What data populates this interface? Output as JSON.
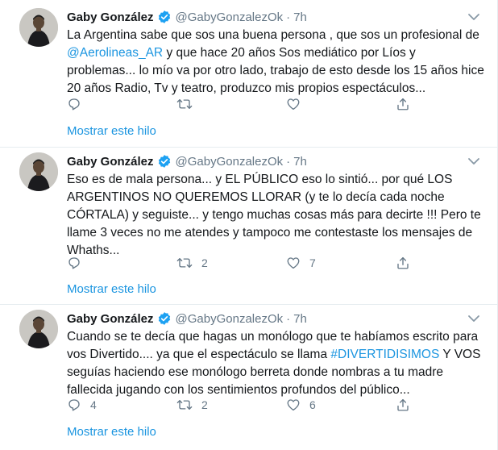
{
  "tweets": [
    {
      "name": "Gaby González",
      "handle": "@GabyGonzalezOk",
      "separator": "·",
      "time": "7h",
      "text_before_link": "La Argentina sabe que sos una buena persona , que sos un profesional de ",
      "link": "@Aerolineas_AR",
      "text_after_link": " y que hace 20 años Sos mediático por Líos y problemas... lo mío va por otro lado, trabajo de esto desde los 15 años hice 20 años Radio, Tv y teatro, produzco mis propios espectáculos...",
      "reply_count": "",
      "retweet_count": "",
      "like_count": "",
      "show_thread": "Mostrar este hilo"
    },
    {
      "name": "Gaby González",
      "handle": "@GabyGonzalezOk",
      "separator": "·",
      "time": "7h",
      "text": "Eso es de mala persona... y EL PÚBLICO eso lo sintió... por qué LOS ARGENTINOS NO QUEREMOS LLORAR (y te lo decía cada noche CÓRTALA) y seguiste... y tengo muchas cosas más para decirte !!! Pero te llame 3 veces no me atendes y tampoco me contestaste los mensajes de Whaths...",
      "reply_count": "",
      "retweet_count": "2",
      "like_count": "7",
      "show_thread": "Mostrar este hilo"
    },
    {
      "name": "Gaby González",
      "handle": "@GabyGonzalezOk",
      "separator": "·",
      "time": "7h",
      "text_before_link": "Cuando se te decía que hagas un monólogo que te habíamos escrito para vos Divertido.... ya que el espectáculo se llama ",
      "link": "#DIVERTIDISIMOS",
      "text_after_link": " Y VOS seguías haciendo ese monólogo berreta donde nombras a tu madre fallecida jugando con los sentimientos profundos del público...",
      "reply_count": "4",
      "retweet_count": "2",
      "like_count": "6",
      "show_thread": "Mostrar este hilo"
    }
  ],
  "icons": {
    "verified": "verified-badge-icon",
    "caret": "chevron-down-icon",
    "reply": "reply-icon",
    "retweet": "retweet-icon",
    "like": "heart-icon",
    "share": "share-icon"
  },
  "colors": {
    "link": "#1b95e0",
    "secondary_text": "#657786",
    "primary_text": "#14171a",
    "divider": "#e6ecf0"
  }
}
